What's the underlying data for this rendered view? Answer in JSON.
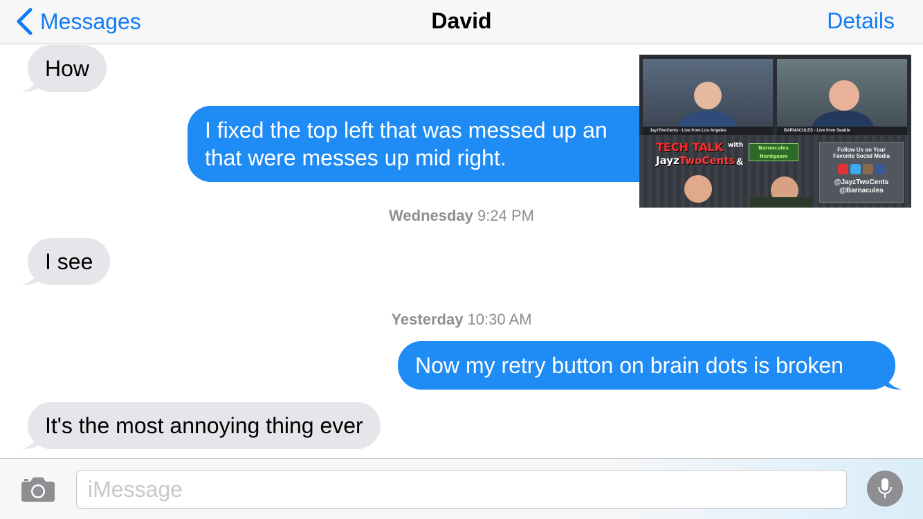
{
  "nav": {
    "back_label": "Messages",
    "title": "David",
    "details_label": "Details"
  },
  "messages": [
    {
      "direction": "incoming",
      "text": "How"
    },
    {
      "direction": "outgoing",
      "text_line1": "I fixed the top left that was messed up an",
      "text_line2": "that were messes up mid right."
    },
    {
      "direction": "incoming",
      "text": "I see"
    },
    {
      "direction": "outgoing",
      "text": "Now my retry button on brain dots is broken"
    },
    {
      "direction": "incoming",
      "text": "It's the most annoying thing ever"
    }
  ],
  "timestamps": [
    {
      "day": "Wednesday",
      "time": "9:24 PM"
    },
    {
      "day": "Yesterday",
      "time": "10:30 AM"
    }
  ],
  "video": {
    "left_caption": "JayzTwoCents - Live from Los Angeles",
    "right_caption": "BARNACULES - Live from Seattle",
    "title_line1": "TECH TALK",
    "with": "with",
    "name_white": "Jayz",
    "name_red": "TwoCents",
    "amp": "&",
    "logo_line1": "Barnacules",
    "logo_line2": "Nerdgasm",
    "follow_line1": "Follow Us on Your",
    "follow_line2": "Favorite Social Media",
    "handle1": "@JayzTwoCents",
    "handle2": "@Barnacules"
  },
  "input": {
    "placeholder": "iMessage"
  },
  "colors": {
    "accent": "#127bf5",
    "outgoing_bubble": "#1f8bf5",
    "incoming_bubble": "#e5e5ea",
    "timestamp": "#8e8e93"
  },
  "icons": {
    "back": "chevron-left-icon",
    "camera": "camera-icon",
    "mic": "microphone-icon"
  }
}
